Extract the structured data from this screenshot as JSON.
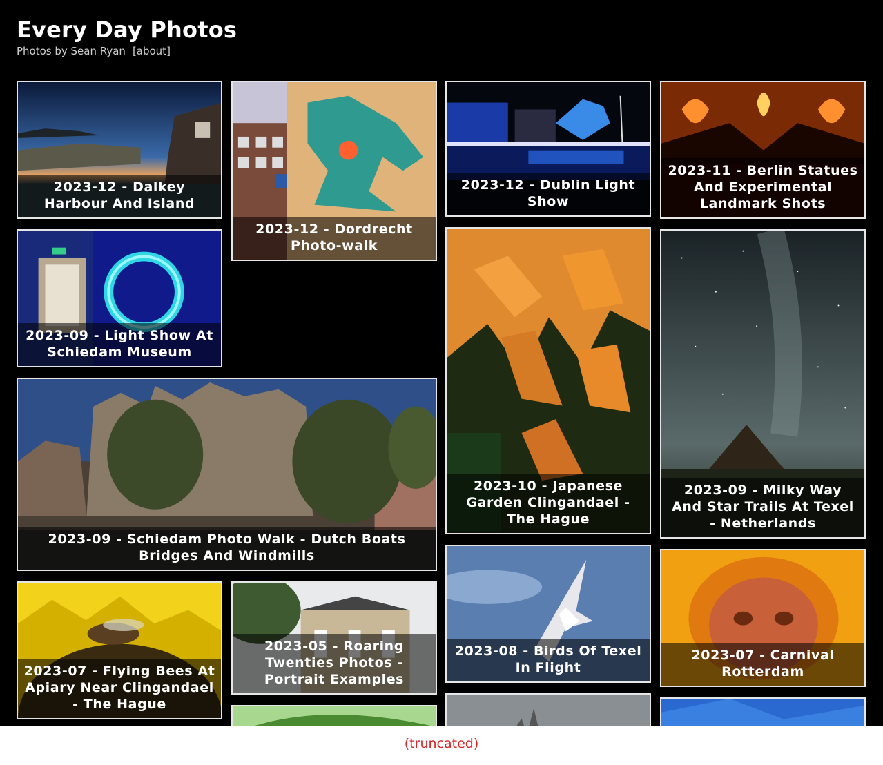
{
  "site": {
    "title": "Every Day Photos",
    "byline": "Photos by Sean Ryan",
    "about_link": "[about]"
  },
  "albums": [
    {
      "id": "dalkey",
      "title": "2023-12 - Dalkey Harbour And Island"
    },
    {
      "id": "dordrecht",
      "title": "2023-12 - Dordrecht Photo-walk"
    },
    {
      "id": "dublin",
      "title": "2023-12 - Dublin Light Show"
    },
    {
      "id": "berlin",
      "title": "2023-11 - Berlin Statues And Experimental Landmark Shots"
    },
    {
      "id": "schiedam-light",
      "title": "2023-09 - Light Show At Schiedam Museum"
    },
    {
      "id": "japanese",
      "title": "2023-10 - Japanese Garden Clingandael - The Hague"
    },
    {
      "id": "milkyway",
      "title": "2023-09 - Milky Way And Star Trails At Texel - Netherlands"
    },
    {
      "id": "schiedam-walk",
      "title": "2023-09 - Schiedam Photo Walk - Dutch Boats Bridges And Windmills"
    },
    {
      "id": "birds",
      "title": "2023-08 - Birds Of Texel In Flight"
    },
    {
      "id": "bees",
      "title": "2023-07 - Flying Bees At Apiary Near Clingandael - The Hague"
    },
    {
      "id": "roaring",
      "title": "2023-05 - Roaring Twenties Photos - Portrait Examples"
    },
    {
      "id": "carnival",
      "title": "2023-07 - Carnival Rotterdam"
    },
    {
      "id": "partial-green",
      "title": ""
    },
    {
      "id": "partial-grey",
      "title": ""
    },
    {
      "id": "partial-blue",
      "title": ""
    }
  ],
  "footer_note": "(truncated)"
}
